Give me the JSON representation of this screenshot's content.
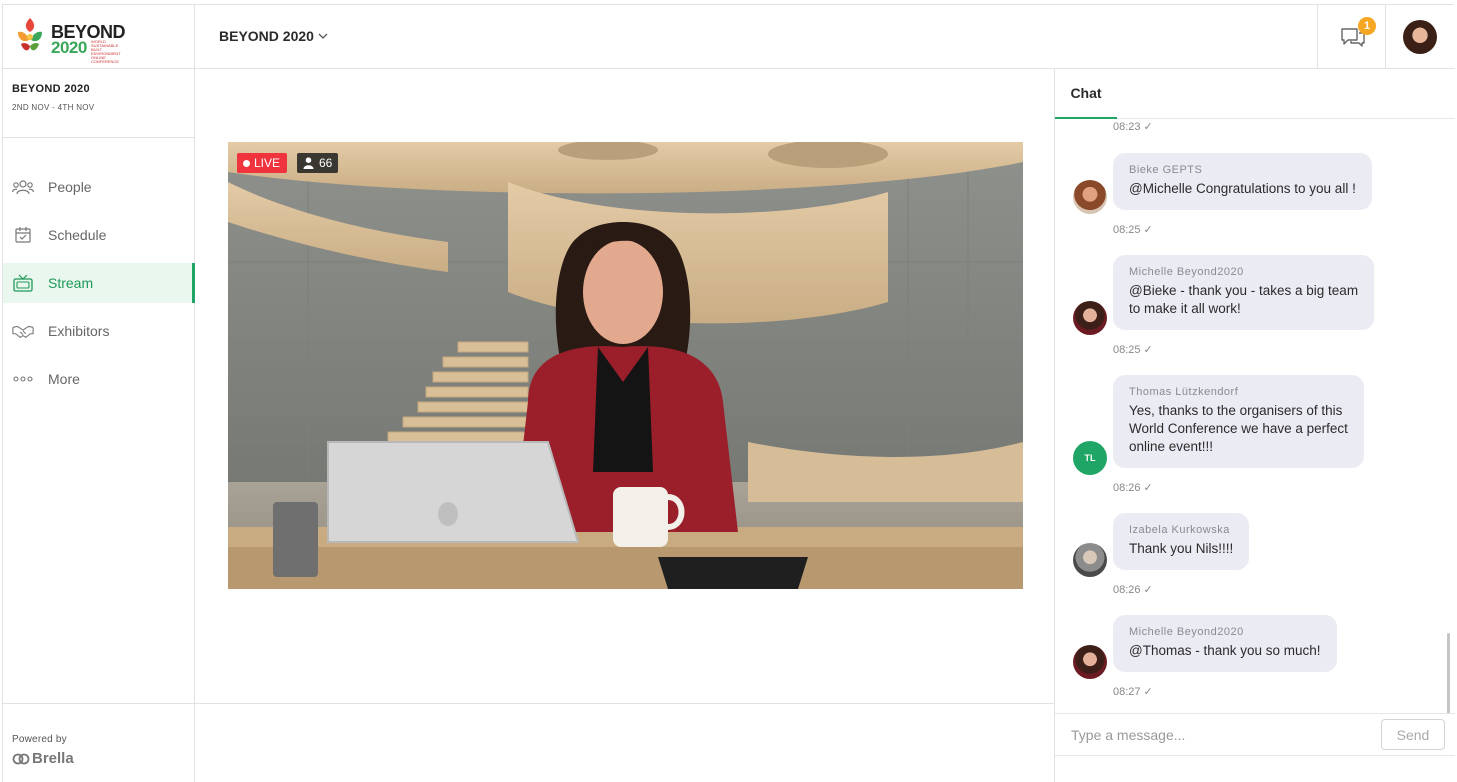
{
  "header": {
    "logo_line1": "BEYOND",
    "logo_line2": "2020",
    "logo_sub": "WORLD SUSTAINABLE BUILT ENVIRONMENT ONLINE CONFERENCE",
    "event_name": "BEYOND 2020",
    "notification_count": "1"
  },
  "sidebar": {
    "event_title": "BEYOND 2020",
    "event_dates": "2ND NOV - 4TH NOV",
    "items": [
      {
        "label": "People",
        "icon": "people-icon"
      },
      {
        "label": "Schedule",
        "icon": "calendar-icon"
      },
      {
        "label": "Stream",
        "icon": "tv-icon",
        "active": true
      },
      {
        "label": "Exhibitors",
        "icon": "handshake-icon"
      },
      {
        "label": "More",
        "icon": "more-icon"
      }
    ],
    "powered_by": "Powered by",
    "brand": "Brella"
  },
  "stream": {
    "live_label": "LIVE",
    "viewer_count": "66"
  },
  "chat": {
    "tab_label": "Chat",
    "top_timestamp": "08:23",
    "messages": [
      {
        "author": "Bieke GEPTS",
        "lines": [
          "@Michelle Congratulations to you all !"
        ],
        "time": "08:25"
      },
      {
        "author": "Michelle Beyond2020",
        "lines": [
          "@Bieke - thank you - takes a big team",
          "to make it all work!"
        ],
        "time": "08:25"
      },
      {
        "author": "Thomas Lützkendorf",
        "initials": "TL",
        "lines": [
          "Yes, thanks to the organisers of this",
          "World Conference we have a perfect",
          "online event!!!"
        ],
        "time": "08:26"
      },
      {
        "author": "Izabela Kurkowska",
        "lines": [
          "Thank you Nils!!!!"
        ],
        "time": "08:26"
      },
      {
        "author": "Michelle Beyond2020",
        "lines": [
          "@Thomas - thank you so much!"
        ],
        "time": "08:27"
      }
    ],
    "input_placeholder": "Type a message...",
    "send_label": "Send"
  },
  "colors": {
    "accent_green": "#1fa565",
    "live_red": "#f0343e",
    "badge_orange": "#f5a623",
    "bubble_bg": "#ebebf3"
  }
}
